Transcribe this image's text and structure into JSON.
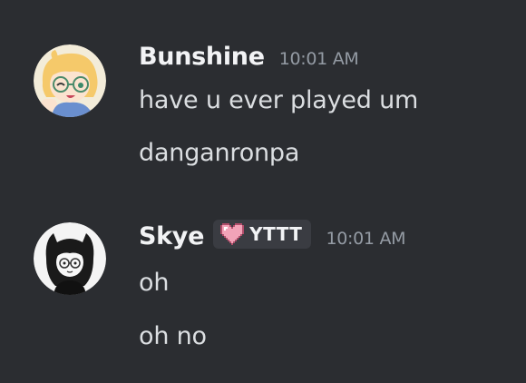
{
  "messages": [
    {
      "author": "Bunshine",
      "timestamp": "10:01 AM",
      "lines": [
        "have u ever played um",
        "danganronpa"
      ]
    },
    {
      "author": "Skye",
      "tag": {
        "icon": "pixel-heart-icon",
        "label": "YTTT"
      },
      "timestamp": "10:01 AM",
      "lines": [
        "oh",
        "oh no"
      ]
    }
  ],
  "colors": {
    "background": "#2b2d31",
    "username": "#f2f3f5",
    "timestamp": "#949ba4",
    "message_text": "#dbdee1",
    "tag_background": "#3a3c42",
    "heart": "#f2a3b8"
  }
}
